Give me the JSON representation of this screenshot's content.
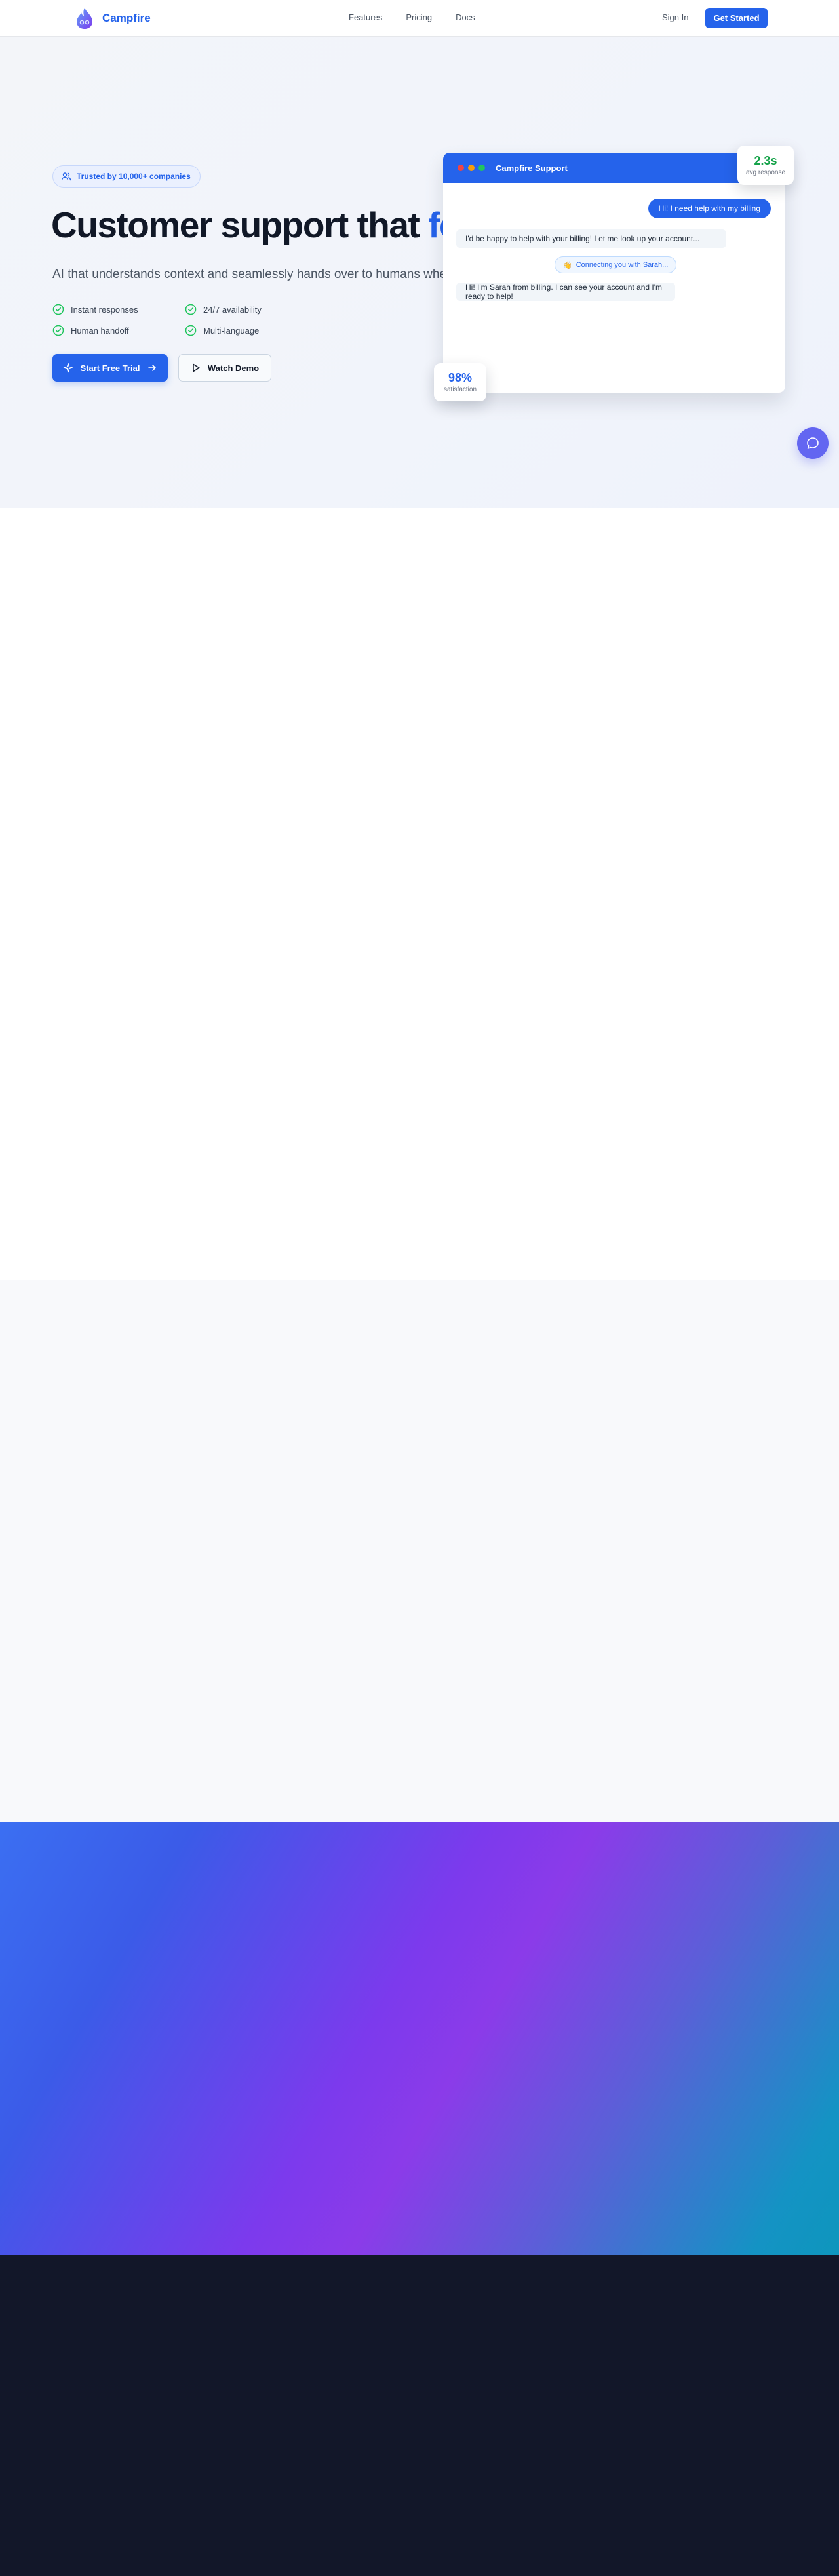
{
  "nav": {
    "brand": "Campfire",
    "links": [
      "Features",
      "Pricing",
      "Docs"
    ],
    "signin": "Sign In",
    "cta": "Get Started"
  },
  "hero": {
    "badge": "Trusted by 10,000+ companies",
    "headline_main": "Customer support that ",
    "headline_accent": "fe",
    "subhead": "AI that understands context and seamlessly hands over to humans when nee",
    "features": [
      "Instant responses",
      "24/7 availability",
      "Human handoff",
      "Multi-language"
    ],
    "primary_cta": "Start Free Trial",
    "secondary_cta": "Watch Demo"
  },
  "chat": {
    "title": "Campfire Support",
    "user_message": "Hi! I need help with my billing",
    "bot_message_1": "I'd be happy to help with your billing! Let me look up your account...",
    "connecting": "Connecting you with Sarah...",
    "connecting_icon": "👋",
    "bot_message_2": "Hi! I'm Sarah from billing. I can see your account and I'm ready to help!",
    "window_dots": [
      "#ef4444",
      "#f59e0b",
      "#22c55e"
    ]
  },
  "stats": {
    "response_value": "2.3s",
    "response_label": "avg response",
    "response_color": "#16a34a",
    "satisfaction_value": "98%",
    "satisfaction_label": "satisfaction",
    "satisfaction_color": "#2563eb"
  },
  "colors": {
    "accent": "#2563eb",
    "fab": "#6366f1",
    "check": "#22c55e"
  },
  "icons": [
    "campfire-logo",
    "users-icon",
    "check-circle-icon",
    "sparkle-icon",
    "arrow-right-icon",
    "play-icon",
    "chat-bubble-icon"
  ]
}
